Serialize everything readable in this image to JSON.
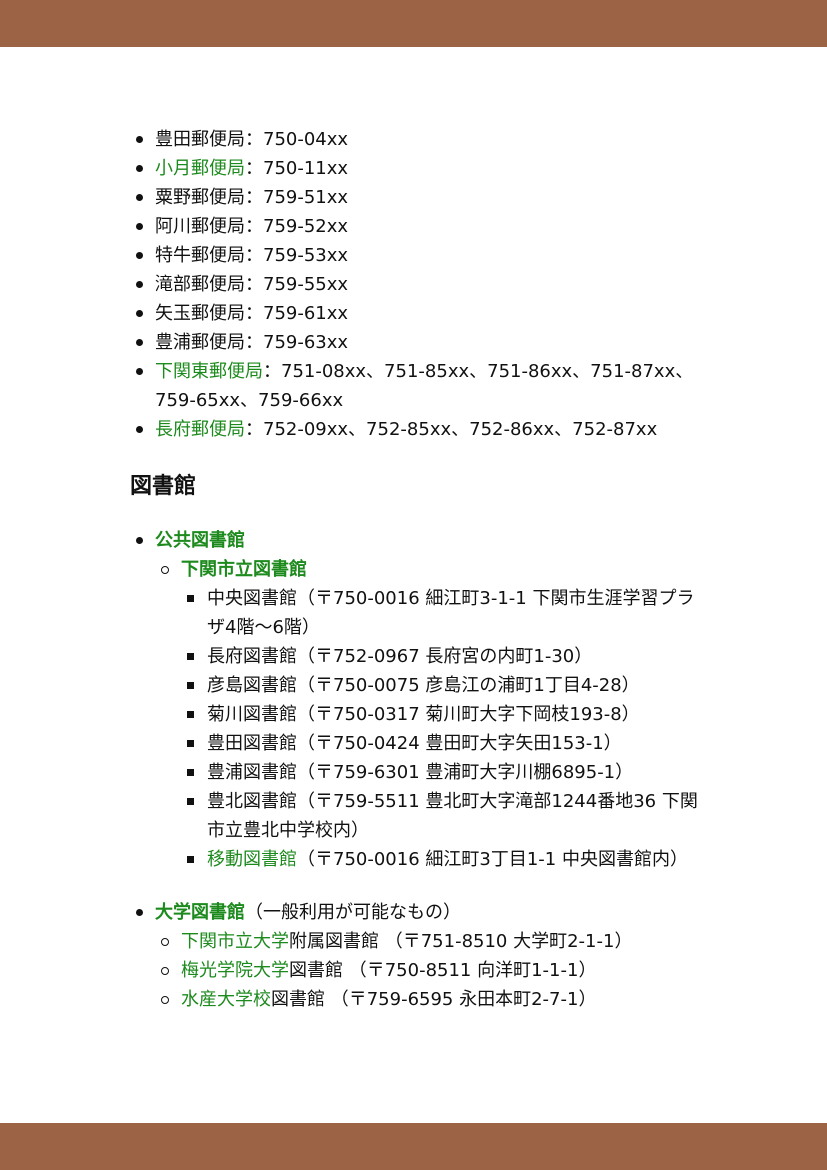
{
  "post_offices": [
    {
      "name": "豊田郵便局",
      "link": false,
      "codes": "：750-04xx"
    },
    {
      "name": "小月郵便局",
      "link": true,
      "codes": "：750-11xx"
    },
    {
      "name": "粟野郵便局",
      "link": false,
      "codes": "：759-51xx"
    },
    {
      "name": "阿川郵便局",
      "link": false,
      "codes": "：759-52xx"
    },
    {
      "name": "特牛郵便局",
      "link": false,
      "codes": "：759-53xx"
    },
    {
      "name": "滝部郵便局",
      "link": false,
      "codes": "：759-55xx"
    },
    {
      "name": "矢玉郵便局",
      "link": false,
      "codes": "：759-61xx"
    },
    {
      "name": "豊浦郵便局",
      "link": false,
      "codes": "：759-63xx"
    },
    {
      "name": "下関東郵便局",
      "link": true,
      "codes": "：751-08xx、751-85xx、751-86xx、751-87xx、759-65xx、759-66xx"
    },
    {
      "name": "長府郵便局",
      "link": true,
      "codes": "：752-09xx、752-85xx、752-86xx、752-87xx"
    }
  ],
  "library": {
    "heading": "図書館",
    "public": {
      "label": "公共図書館",
      "city_library": {
        "label": "下関市立図書館",
        "branches": [
          {
            "name": "中央図書館",
            "link": false,
            "detail": "（〒750-0016 細江町3-1-1 下関市生涯学習プラザ4階〜6階）"
          },
          {
            "name": "長府図書館",
            "link": false,
            "detail": "（〒752-0967 長府宮の内町1-30）"
          },
          {
            "name": "彦島図書館",
            "link": false,
            "detail": "（〒750-0075 彦島江の浦町1丁目4-28）"
          },
          {
            "name": "菊川図書館",
            "link": false,
            "detail": "（〒750-0317 菊川町大字下岡枝193-8）"
          },
          {
            "name": "豊田図書館",
            "link": false,
            "detail": "（〒750-0424 豊田町大字矢田153-1）"
          },
          {
            "name": "豊浦図書館",
            "link": false,
            "detail": "（〒759-6301 豊浦町大字川棚6895-1）"
          },
          {
            "name": "豊北図書館",
            "link": false,
            "detail": "（〒759-5511 豊北町大字滝部1244番地36 下関市立豊北中学校内）"
          },
          {
            "name": "移動図書館",
            "link": true,
            "detail": "（〒750-0016 細江町3丁目1-1 中央図書館内）"
          }
        ]
      }
    },
    "university": {
      "label": "大学図書館",
      "note": "（一般利用が可能なもの）",
      "items": [
        {
          "school": "下関市立大学",
          "rest": "附属図書館 （〒751-8510 大学町2-1-1）"
        },
        {
          "school": "梅光学院大学",
          "rest": "図書館 （〒750-8511 向洋町1-1-1）"
        },
        {
          "school": "水産大学校",
          "rest": "図書館 （〒759-6595 永田本町2-7-1）"
        }
      ]
    }
  }
}
